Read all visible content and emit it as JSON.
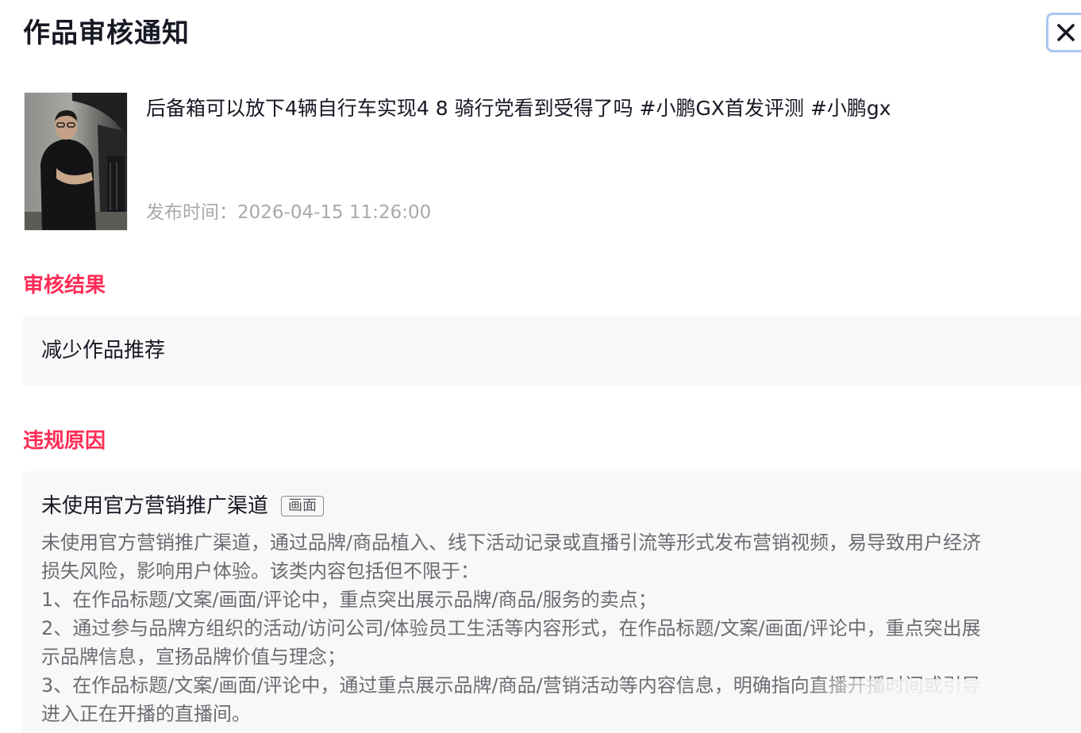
{
  "dialog": {
    "title": "作品审核通知",
    "close_icon": "close-icon"
  },
  "video": {
    "title": "后备箱可以放下4辆自行车实现4 8 骑行党看到受得了吗 #小鹏GX首发评测 #小鹏gx",
    "publish_label": "发布时间：",
    "publish_time": "2026-04-15 11:26:00"
  },
  "result": {
    "heading": "审核结果",
    "text": "减少作品推荐"
  },
  "violation": {
    "heading": "违规原因",
    "name": "未使用官方营销推广渠道",
    "tag": "画面",
    "desc_lines": [
      "未使用官方营销推广渠道，通过品牌/商品植入、线下活动记录或直播引流等形式发布营销视频，易导致用户经济",
      "损失风险，影响用户体验。该类内容包括但不限于：",
      "1、在作品标题/文案/画面/评论中，重点突出展示品牌/商品/服务的卖点；",
      "2、通过参与品牌方组织的活动/访问公司/体验员工生活等内容形式，在作品标题/文案/画面/评论中，重点突出展",
      "示品牌信息，宣扬品牌价值与理念；",
      "3、在作品标题/文案/画面/评论中，通过重点展示品牌/商品/营销活动等内容信息，明确指向直播开播时间或引导",
      "进入正在开播的直播间。"
    ]
  },
  "colors": {
    "accent": "#fe2c55",
    "text_primary": "#161823",
    "text_secondary": "#6b6c72",
    "muted": "#a8a9ad",
    "box_bg": "#f8f8f8"
  }
}
